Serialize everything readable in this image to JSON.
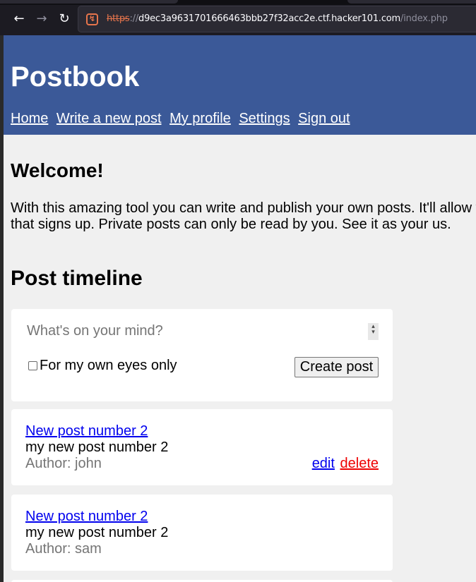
{
  "browser": {
    "url_scheme": "https",
    "url_separator": "://",
    "url_host": "d9ec3a9631701666463bbb27f32acc2e.ctf.hacker101.com",
    "url_path": "/index.php"
  },
  "site": {
    "brand": "Postbook",
    "nav": [
      "Home",
      "Write a new post",
      "My profile",
      "Settings",
      "Sign out"
    ]
  },
  "main": {
    "welcome": "Welcome!",
    "intro": "With this amazing tool you can write and publish your own posts. It'll allow y anyone that signs up. Private posts can only be read by you. See it as your us.",
    "timeline_title": "Post timeline"
  },
  "compose": {
    "placeholder": "What's on your mind?",
    "private_label": "For my own eyes only",
    "submit_label": "Create post"
  },
  "posts": [
    {
      "title": "New post number 2",
      "body": "my new post number 2",
      "author": "Author: john",
      "edit_label": "edit",
      "delete_label": "delete"
    },
    {
      "title": "New post number 2",
      "body": "my new post number 2",
      "author": "Author: sam"
    }
  ],
  "colors": {
    "header_bg": "#3b5998",
    "link": "#0000ee",
    "delete": "#ee0000",
    "page_bg": "#f0f0f0"
  }
}
